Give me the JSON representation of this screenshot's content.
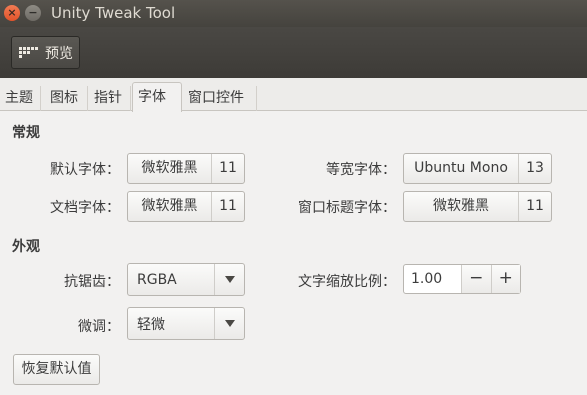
{
  "window": {
    "title": "Unity Tweak Tool",
    "close_glyph": "×",
    "min_glyph": "−"
  },
  "toolbar": {
    "preview_label": "预览",
    "preview_icon": "grid-icon"
  },
  "tabs": [
    {
      "label": "主题"
    },
    {
      "label": "图标"
    },
    {
      "label": "指针"
    },
    {
      "label": "字体",
      "active": true
    },
    {
      "label": "窗口控件"
    }
  ],
  "sections": {
    "general_title": "常规",
    "appearance_title": "外观"
  },
  "general": {
    "default_font_label": "默认字体：",
    "default_font_name": "微软雅黑",
    "default_font_size": "11",
    "monospace_font_label": "等宽字体：",
    "monospace_font_name": "Ubuntu Mono",
    "monospace_font_size": "13",
    "document_font_label": "文档字体：",
    "document_font_name": "微软雅黑",
    "document_font_size": "11",
    "title_font_label": "窗口标题字体：",
    "title_font_name": "微软雅黑",
    "title_font_size": "11"
  },
  "appearance": {
    "antialias_label": "抗锯齿：",
    "antialias_value": "RGBA",
    "hinting_label": "微调：",
    "hinting_value": "轻微",
    "scale_label": "文字缩放比例：",
    "scale_value": "1.00",
    "scale_minus": "−",
    "scale_plus": "+"
  },
  "reset_label": "恢复默认值"
}
